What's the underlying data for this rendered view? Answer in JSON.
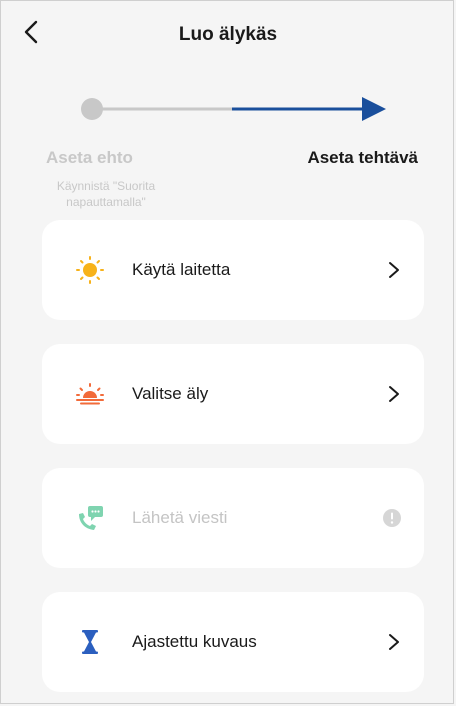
{
  "header": {
    "title": "Luo älykäs"
  },
  "stepper": {
    "step1": {
      "label": "Aseta ehto",
      "sub": "Käynnistä \"Suorita napauttamalla\""
    },
    "step2": {
      "label": "Aseta tehtävä"
    }
  },
  "actions": [
    {
      "label": "Käytä laitetta",
      "icon": "sun-icon",
      "enabled": true
    },
    {
      "label": "Valitse äly",
      "icon": "sunrise-icon",
      "enabled": true
    },
    {
      "label": "Lähetä viesti",
      "icon": "message-phone-icon",
      "enabled": false
    },
    {
      "label": "Ajastettu kuvaus",
      "icon": "hourglass-icon",
      "enabled": true
    }
  ],
  "colors": {
    "accent": "#1a4f9c",
    "inactive": "#c8c8c8",
    "sun": "#f7b21a",
    "sunrise": "#f26b3a",
    "message": "#7fd4b0",
    "hourglass": "#2b5fbf"
  }
}
